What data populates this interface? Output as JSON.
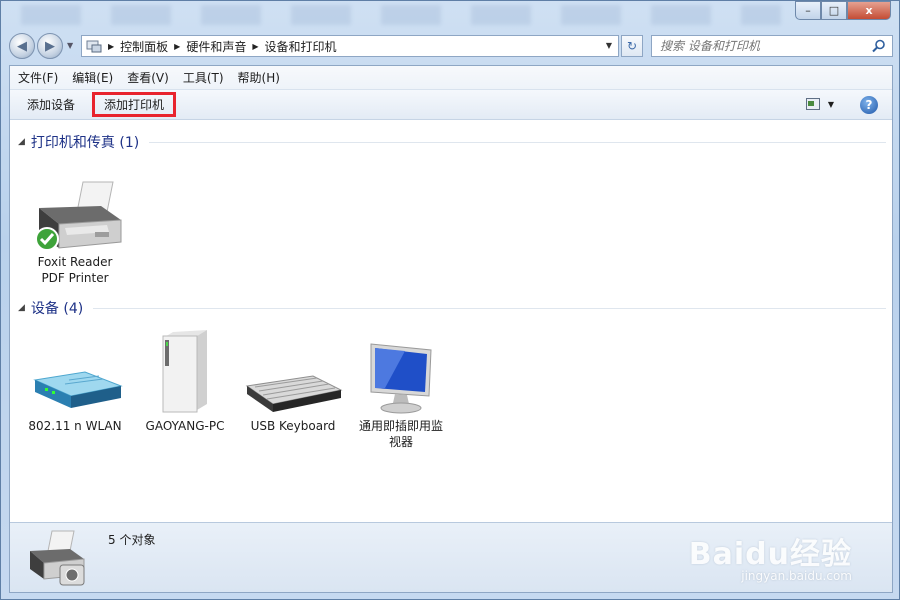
{
  "window": {
    "minimize": "–",
    "maximize": "□",
    "close": "x"
  },
  "nav": {
    "back": "◀",
    "forward": "▶",
    "breadcrumbs": [
      "控制面板",
      "硬件和声音",
      "设备和打印机"
    ],
    "search_placeholder": "搜索 设备和打印机",
    "refresh": "↻"
  },
  "menu": {
    "items": [
      "文件(F)",
      "编辑(E)",
      "查看(V)",
      "工具(T)",
      "帮助(H)"
    ]
  },
  "toolbar": {
    "add_device": "添加设备",
    "add_printer": "添加打印机",
    "help": "?"
  },
  "groups": {
    "printers": {
      "title": "打印机和传真 (1)",
      "devices": [
        {
          "name_line1": "Foxit Reader",
          "name_line2": "PDF Printer",
          "icon": "printer-icon",
          "default": true
        }
      ]
    },
    "devices": {
      "title": "设备 (4)",
      "devices": [
        {
          "name_line1": "802.11 n WLAN",
          "name_line2": "",
          "icon": "router-icon"
        },
        {
          "name_line1": "GAOYANG-PC",
          "name_line2": "",
          "icon": "computer-tower-icon"
        },
        {
          "name_line1": "USB Keyboard",
          "name_line2": "",
          "icon": "keyboard-icon"
        },
        {
          "name_line1": "通用即插即用监",
          "name_line2": "视器",
          "icon": "monitor-icon"
        }
      ]
    }
  },
  "status": {
    "count_text": "5 个对象"
  },
  "watermark": {
    "logo": "Baidu经验",
    "url": "jingyan.baidu.com"
  },
  "colors": {
    "highlight_border": "#e8232d",
    "group_title": "#1e3287"
  }
}
